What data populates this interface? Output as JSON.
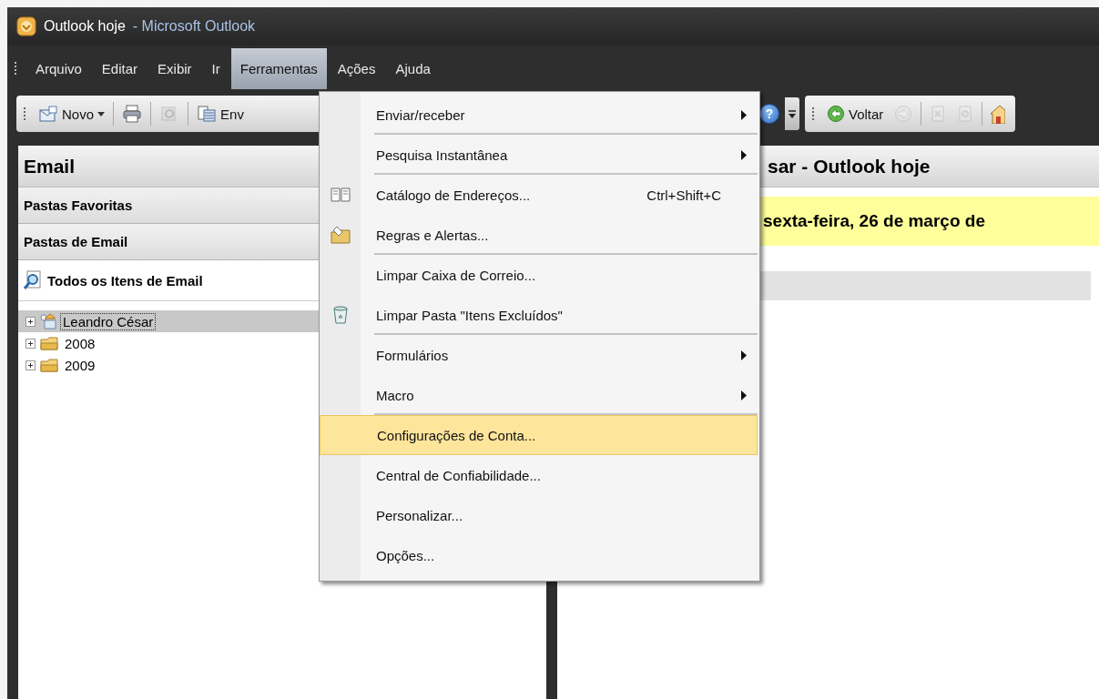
{
  "window": {
    "title": "Outlook hoje",
    "subtitle": "- Microsoft Outlook"
  },
  "menubar": [
    {
      "label": "Arquivo",
      "selected": false
    },
    {
      "label": "Editar",
      "selected": false
    },
    {
      "label": "Exibir",
      "selected": false
    },
    {
      "label": "Ir",
      "selected": false
    },
    {
      "label": "Ferramentas",
      "selected": true
    },
    {
      "label": "Ações",
      "selected": false
    },
    {
      "label": "Ajuda",
      "selected": false
    }
  ],
  "toolbar": {
    "left": [
      {
        "kind": "new",
        "label": "Novo",
        "disabled": false
      },
      {
        "kind": "print",
        "disabled": false
      },
      {
        "kind": "sync",
        "disabled": true
      },
      {
        "kind": "send",
        "label": "Env",
        "disabled": false
      }
    ],
    "right": [
      {
        "kind": "help",
        "symbol": "?"
      },
      {
        "kind": "overflow"
      }
    ],
    "nav": [
      [
        {
          "kind": "back",
          "label": "Voltar",
          "disabled": false
        },
        {
          "kind": "forward",
          "disabled": true
        }
      ],
      [
        {
          "kind": "stop",
          "disabled": true
        },
        {
          "kind": "refresh",
          "disabled": true
        }
      ],
      [
        {
          "kind": "home",
          "disabled": false
        }
      ]
    ]
  },
  "navigation_pane": {
    "title": "Email",
    "sections": [
      "Pastas Favoritas",
      "Pastas de Email"
    ],
    "all_items": "Todos os Itens de Email",
    "folders": [
      {
        "label": "Leandro César",
        "kind": "account",
        "expanded": false,
        "selected": true
      },
      {
        "label": "2008",
        "kind": "folder",
        "expanded": false,
        "selected": false
      },
      {
        "label": "2009",
        "kind": "folder",
        "expanded": false,
        "selected": false
      }
    ]
  },
  "content": {
    "title": "sar - Outlook hoje",
    "date": "sexta-feira, 26 de março de"
  },
  "tools_menu": [
    {
      "label": "Enviar/receber",
      "kind": "plain",
      "submenu": true,
      "separator_after": true,
      "selected": false
    },
    {
      "label": "Pesquisa Instantânea",
      "kind": "plain",
      "submenu": true,
      "separator_after": true,
      "selected": false
    },
    {
      "label": "Catálogo de Endereços...",
      "kind": "book",
      "shortcut": "Ctrl+Shift+C",
      "submenu": false,
      "separator_after": false,
      "selected": false
    },
    {
      "label": "Regras e Alertas...",
      "kind": "rules",
      "submenu": false,
      "separator_after": true,
      "selected": false
    },
    {
      "label": "Limpar Caixa de Correio...",
      "kind": "plain",
      "submenu": false,
      "separator_after": false,
      "selected": false
    },
    {
      "label": "Limpar Pasta \"Itens Excluídos\"",
      "kind": "bin",
      "submenu": false,
      "separator_after": true,
      "selected": false
    },
    {
      "label": "Formulários",
      "kind": "plain",
      "submenu": true,
      "separator_after": false,
      "selected": false
    },
    {
      "label": "Macro",
      "kind": "plain",
      "submenu": true,
      "separator_after": true,
      "selected": false
    },
    {
      "label": "Configurações de Conta...",
      "kind": "plain",
      "submenu": false,
      "separator_after": false,
      "selected": true
    },
    {
      "label": "Central de Confiabilidade...",
      "kind": "plain",
      "submenu": false,
      "separator_after": false,
      "selected": false
    },
    {
      "label": "Personalizar...",
      "kind": "plain",
      "submenu": false,
      "separator_after": false,
      "selected": false
    },
    {
      "label": "Opções...",
      "kind": "plain",
      "submenu": false,
      "separator_after": false,
      "selected": false
    }
  ]
}
